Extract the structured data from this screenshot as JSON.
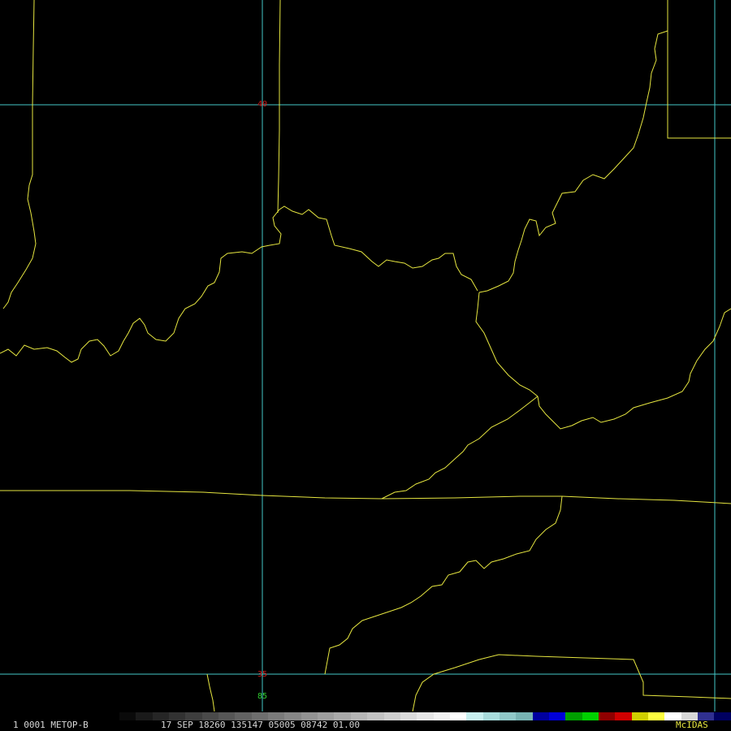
{
  "map": {
    "grid_labels": {
      "lat_top": "40",
      "lat_bottom": "35",
      "lon": "85"
    },
    "colors": {
      "background": "#000000",
      "borders": "#e6e640",
      "grid": "#44c8c8",
      "lat_label": "#d01818",
      "lon_label": "#30d030"
    }
  },
  "statusbar": {
    "frame": "1 0001",
    "satellite": "METOP-B",
    "info": "17 SEP 18260 135147 05005 08742 01.00",
    "logo": "McIDAS"
  },
  "colorbar": {
    "colors": [
      "#0a0a0a",
      "#1a1a1a",
      "#262626",
      "#323232",
      "#3e3e3e",
      "#4a4a4a",
      "#565656",
      "#626262",
      "#6e6e6e",
      "#7a7a7a",
      "#868686",
      "#929292",
      "#9e9e9e",
      "#aaaaaa",
      "#b6b6b6",
      "#c2c2c2",
      "#cecece",
      "#dadada",
      "#e6e6e6",
      "#f2f2f2",
      "#ffffff",
      "#c8f0f0",
      "#a8dcdc",
      "#90c8c8",
      "#78b4b4",
      "#0000a0",
      "#0000d8",
      "#00a000",
      "#00d000",
      "#900000",
      "#d00000",
      "#d0d000",
      "#ffff40",
      "#ffffff",
      "#d8d8d8",
      "#303090",
      "#000060"
    ]
  }
}
